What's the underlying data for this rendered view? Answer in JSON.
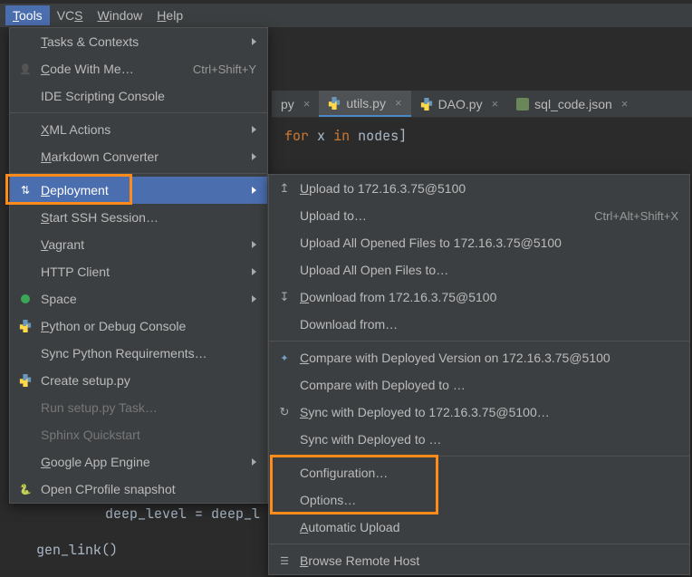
{
  "menubar": {
    "items": [
      "Tools",
      "VCS",
      "Window",
      "Help"
    ],
    "mnemonic_chars": [
      "T",
      "S",
      "W",
      "H"
    ],
    "open_index": 0
  },
  "tabs": {
    "items": [
      {
        "name_suffix": "py",
        "kind": "py"
      },
      {
        "name": "utils.py",
        "kind": "py",
        "active": true
      },
      {
        "name": "DAO.py",
        "kind": "py"
      },
      {
        "name": "sql_code.json",
        "kind": "json"
      }
    ]
  },
  "code_line": {
    "kw1": "for",
    "var": "x",
    "kw2": "in",
    "expr": "nodes]"
  },
  "code_bottom": {
    "line1_a": "deep_level ",
    "line1_b": "= deep_l",
    "line2": "gen_link()"
  },
  "tools_menu": [
    {
      "label": "Tasks & Contexts",
      "submenu": true,
      "mn": "T"
    },
    {
      "label": "Code With Me…",
      "shortcut": "Ctrl+Shift+Y",
      "icon": "person",
      "mn": "C"
    },
    {
      "label": "IDE Scripting Console"
    },
    {
      "sep": true
    },
    {
      "label": "XML Actions",
      "submenu": true,
      "mn": "X"
    },
    {
      "label": "Markdown Converter",
      "submenu": true,
      "mn": "M"
    },
    {
      "sep": true
    },
    {
      "label": "Deployment",
      "submenu": true,
      "mn": "D",
      "hover": true,
      "icon": "deploy"
    },
    {
      "label": "Start SSH Session…",
      "mn": "S"
    },
    {
      "label": "Vagrant",
      "submenu": true,
      "mn": "V"
    },
    {
      "label": "HTTP Client",
      "submenu": true
    },
    {
      "label": "Space",
      "submenu": true,
      "icon": "space"
    },
    {
      "label": "Python or Debug Console",
      "icon": "py",
      "mn": "P"
    },
    {
      "label": "Sync Python Requirements…"
    },
    {
      "label": "Create setup.py",
      "icon": "py"
    },
    {
      "label": "Run setup.py Task…",
      "disabled": true
    },
    {
      "label": "Sphinx Quickstart",
      "disabled": true
    },
    {
      "label": "Google App Engine",
      "submenu": true,
      "mn": "G"
    },
    {
      "label": "Open CProfile snapshot",
      "icon": "snap"
    }
  ],
  "deploy_menu": {
    "server": "172.16.3.75@5100",
    "items": [
      {
        "label": "Upload to 172.16.3.75@5100",
        "icon": "upload",
        "mn": "U"
      },
      {
        "label": "Upload to…",
        "shortcut": "Ctrl+Alt+Shift+X"
      },
      {
        "label": "Upload All Opened Files to 172.16.3.75@5100"
      },
      {
        "label": "Upload All Open Files to…"
      },
      {
        "label": "Download from 172.16.3.75@5100",
        "icon": "download",
        "mn": "D"
      },
      {
        "label": "Download from…"
      },
      {
        "sep": true
      },
      {
        "label": "Compare with Deployed Version on 172.16.3.75@5100",
        "icon": "compare",
        "mn": "C"
      },
      {
        "label": "Compare with Deployed to …"
      },
      {
        "label": "Sync with Deployed to 172.16.3.75@5100…",
        "icon": "sync",
        "mn": "S"
      },
      {
        "label": "Sync with Deployed to …"
      },
      {
        "sep": true
      },
      {
        "label": "Configuration…"
      },
      {
        "label": "Options…"
      },
      {
        "label": "Automatic Upload",
        "mn": "A"
      },
      {
        "sep": true
      },
      {
        "label": "Browse Remote Host",
        "icon": "list",
        "mn": "B"
      }
    ]
  }
}
